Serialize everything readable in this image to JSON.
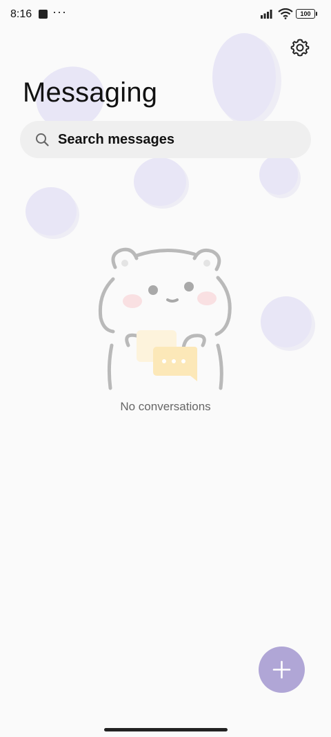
{
  "status_bar": {
    "time": "8:16",
    "overflow": "···",
    "battery": "100"
  },
  "header": {
    "title": "Messaging",
    "settings_icon": "gear-icon"
  },
  "search": {
    "placeholder": "Search messages",
    "icon": "search-icon"
  },
  "empty_state": {
    "text": "No conversations",
    "illustration": "bear-illustration"
  },
  "fab": {
    "icon": "plus-icon"
  },
  "colors": {
    "accent": "#b0a6d6",
    "blob": "#e8e6f6",
    "background": "#fafafa"
  }
}
